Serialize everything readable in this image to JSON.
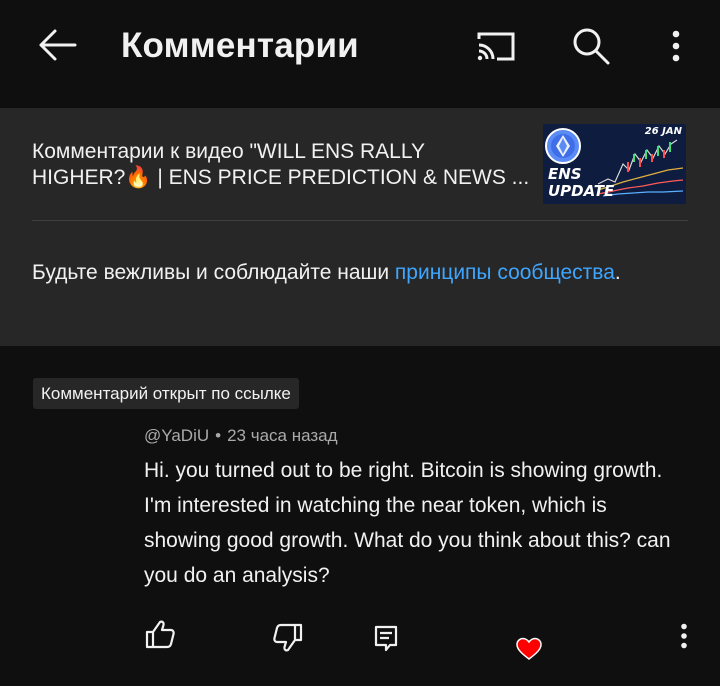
{
  "header": {
    "title": "Комментарии",
    "back_icon": "arrow-left-icon",
    "cast_icon": "cast-icon",
    "search_icon": "search-icon",
    "more_icon": "more-vertical-icon"
  },
  "video_info": {
    "title_line1": "Комментарии к видео \"WILL ENS RALLY",
    "title_line2_a": "HIGHER?",
    "title_line2_emoji": "🔥",
    "title_line2_b": " | ENS PRICE PREDICTION & NEWS ...",
    "thumbnail": {
      "date_label": "26 JAN",
      "text_line1": "ENS",
      "text_line2": "UPDATE"
    }
  },
  "guidelines": {
    "text": "Будьте вежливы и соблюдайте наши ",
    "link": "принципы сообщества",
    "end": "."
  },
  "comment": {
    "badge": "Комментарий открыт по ссылке",
    "author": "@YaDiU",
    "separator": "•",
    "time": "23 часа назад",
    "text": "Hi. you turned out to be right. Bitcoin is showing growth. I'm interested in watching the near token, which is showing good growth. What do you think about this? can you do an analysis?",
    "actions": {
      "like_icon": "thumbs-up-icon",
      "dislike_icon": "thumbs-down-icon",
      "reply_icon": "reply-icon",
      "heart_icon": "heart-icon",
      "more_icon": "more-vertical-icon"
    }
  },
  "colors": {
    "background": "#0f0f0f",
    "panel": "#272727",
    "link": "#3ea6ff",
    "heart": "#ff0000",
    "secondary_text": "#aaaaaa"
  }
}
